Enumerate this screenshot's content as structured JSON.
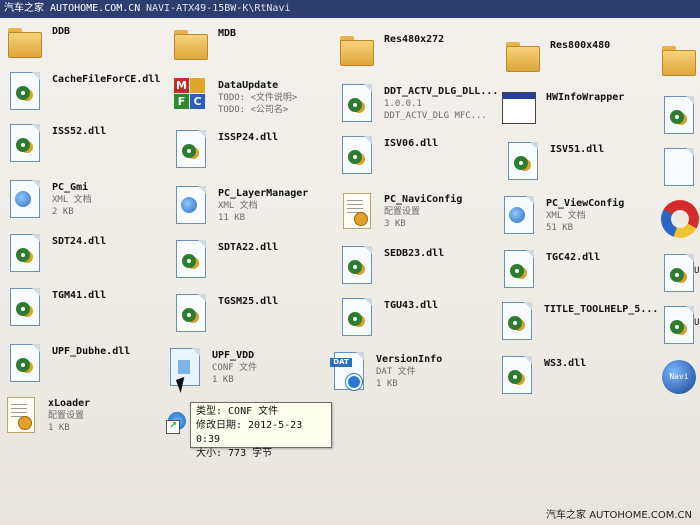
{
  "window": {
    "watermark": "汽车之家 AUTOHOME.COM.CN",
    "path": "NAVI-ATX49-15BW-K\\RtNavi"
  },
  "files": [
    {
      "name": "DDB",
      "type": "folder"
    },
    {
      "name": "MDB",
      "type": "folder"
    },
    {
      "name": "Res480x272",
      "type": "folder"
    },
    {
      "name": "Res800x480",
      "type": "folder"
    },
    {
      "name": "CacheFileForCE.dll",
      "type": "dll"
    },
    {
      "name": "DataUpdate",
      "sub1": "TODO: <文件说明>",
      "sub2": "TODO: <公司名>",
      "type": "mfc"
    },
    {
      "name": "DDT_ACTV_DLG_DLL...",
      "sub1": "1.0.0.1",
      "sub2": "DDT_ACTV_DLG MFC...",
      "type": "dll"
    },
    {
      "name": "HWInfoWrapper",
      "type": "window"
    },
    {
      "name": "ISS52.dll",
      "type": "dll"
    },
    {
      "name": "ISSP24.dll",
      "type": "dll"
    },
    {
      "name": "ISV06.dll",
      "type": "dll"
    },
    {
      "name": "ISV51.dll",
      "type": "dll"
    },
    {
      "name": "PC_Gmi",
      "sub1": "XML 文档",
      "sub2": "2 KB",
      "type": "xml"
    },
    {
      "name": "PC_LayerManager",
      "sub1": "XML 文档",
      "sub2": "11 KB",
      "type": "xml"
    },
    {
      "name": "PC_NaviConfig",
      "sub1": "配置设置",
      "sub2": "3 KB",
      "type": "config"
    },
    {
      "name": "PC_ViewConfig",
      "sub1": "XML 文档",
      "sub2": "51 KB",
      "type": "xml"
    },
    {
      "name": "SDT24.dll",
      "type": "dll"
    },
    {
      "name": "SDTA22.dll",
      "type": "dll"
    },
    {
      "name": "SEDB23.dll",
      "type": "dll"
    },
    {
      "name": "TGC42.dll",
      "type": "dll"
    },
    {
      "name": "TGM41.dll",
      "type": "dll"
    },
    {
      "name": "TGSM25.dll",
      "type": "dll"
    },
    {
      "name": "TGU43.dll",
      "type": "dll"
    },
    {
      "name": "TITLE_TOOLHELP_5...",
      "type": "dll"
    },
    {
      "name": "UPF_Dubhe.dll",
      "type": "dll"
    },
    {
      "name": "UPF_VDD",
      "sub1": "CONF 文件",
      "sub2": "1 KB",
      "type": "conf"
    },
    {
      "name": "VersionInfo",
      "sub1": "DAT 文件",
      "sub2": "1 KB",
      "type": "dat"
    },
    {
      "name": "WS3.dll",
      "type": "dll"
    },
    {
      "name": "xLoader",
      "sub1": "配置设置",
      "sub2": "1 KB",
      "type": "config"
    }
  ],
  "edge": {
    "ringicon_label": "",
    "partial_u1": "U",
    "partial_u2": "U",
    "globe_text": "Navi"
  },
  "tooltip": {
    "type_line": "类型: CONF 文件",
    "date_line": "修改日期: 2012-5-23 0:39",
    "size_line": "大小: 773 字节"
  },
  "footer": "汽车之家 AUTOHOME.COM.CN"
}
